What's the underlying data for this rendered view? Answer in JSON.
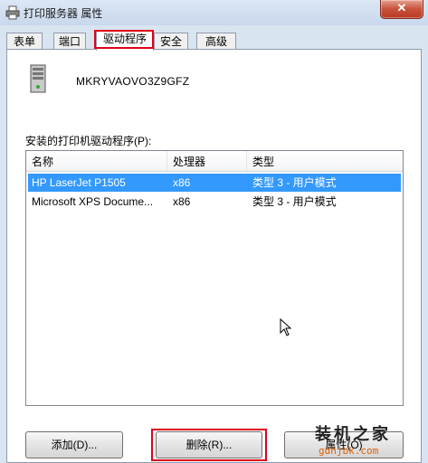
{
  "window": {
    "title": "打印服务器 属性",
    "close_label": "✕"
  },
  "tabs": [
    "表单",
    "端口",
    "驱动程序",
    "安全",
    "高级"
  ],
  "active_tab": "驱动程序",
  "server": {
    "name": "MKRYVAOVO3Z9GFZ"
  },
  "drivers": {
    "label": "安装的打印机驱动程序(P):",
    "columns": [
      "名称",
      "处理器",
      "类型"
    ],
    "rows": [
      {
        "name": "HP LaserJet P1505",
        "processor": "x86",
        "type": "类型 3 - 用户模式",
        "selected": true
      },
      {
        "name": "Microsoft XPS Docume...",
        "processor": "x86",
        "type": "类型 3 - 用户模式",
        "selected": false
      }
    ]
  },
  "buttons": {
    "add": "添加(D)...",
    "remove": "删除(R)...",
    "properties": "属性(O)"
  },
  "watermark": {
    "main": "装机之家",
    "sub": "gdhjbk.com"
  },
  "colors": {
    "selection": "#3399ff",
    "highlight_box": "#e0001a"
  }
}
